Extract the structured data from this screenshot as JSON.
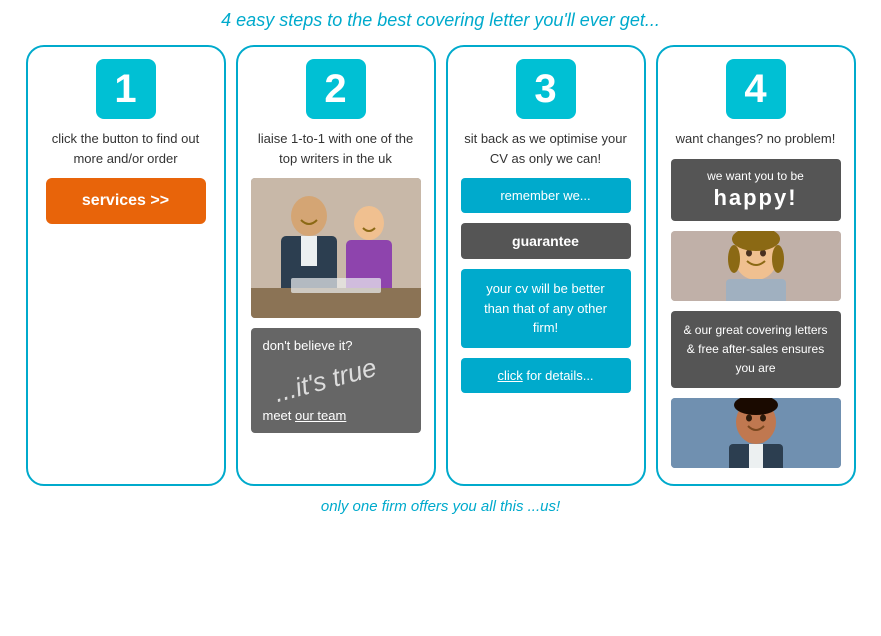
{
  "header": {
    "title": "4 easy steps to the best covering letter you'll ever get..."
  },
  "columns": [
    {
      "step": "1",
      "description": "click the button to find out more and/or order",
      "button_label": "services >>"
    },
    {
      "step": "2",
      "description": "liaise 1-to-1 with one of the top writers in the uk",
      "dark_box": {
        "line1": "don't believe it?",
        "line2": "...it's true",
        "line3": "meet ",
        "link": "our team"
      }
    },
    {
      "step": "3",
      "description": "sit back as we optimise your CV as only we can!",
      "remember": "remember we...",
      "guarantee": "guarantee",
      "cv_better": "your cv will be better than that of any other firm!",
      "click_text": "click",
      "for_details": " for details..."
    },
    {
      "step": "4",
      "description": "want changes? no problem!",
      "happy_line1": "we want you to be",
      "happy_line2": "happy!",
      "covering_text": "& our great covering letters & free after-sales ensures you are"
    }
  ],
  "footer": {
    "text": "only one firm offers you all this ...us!"
  }
}
